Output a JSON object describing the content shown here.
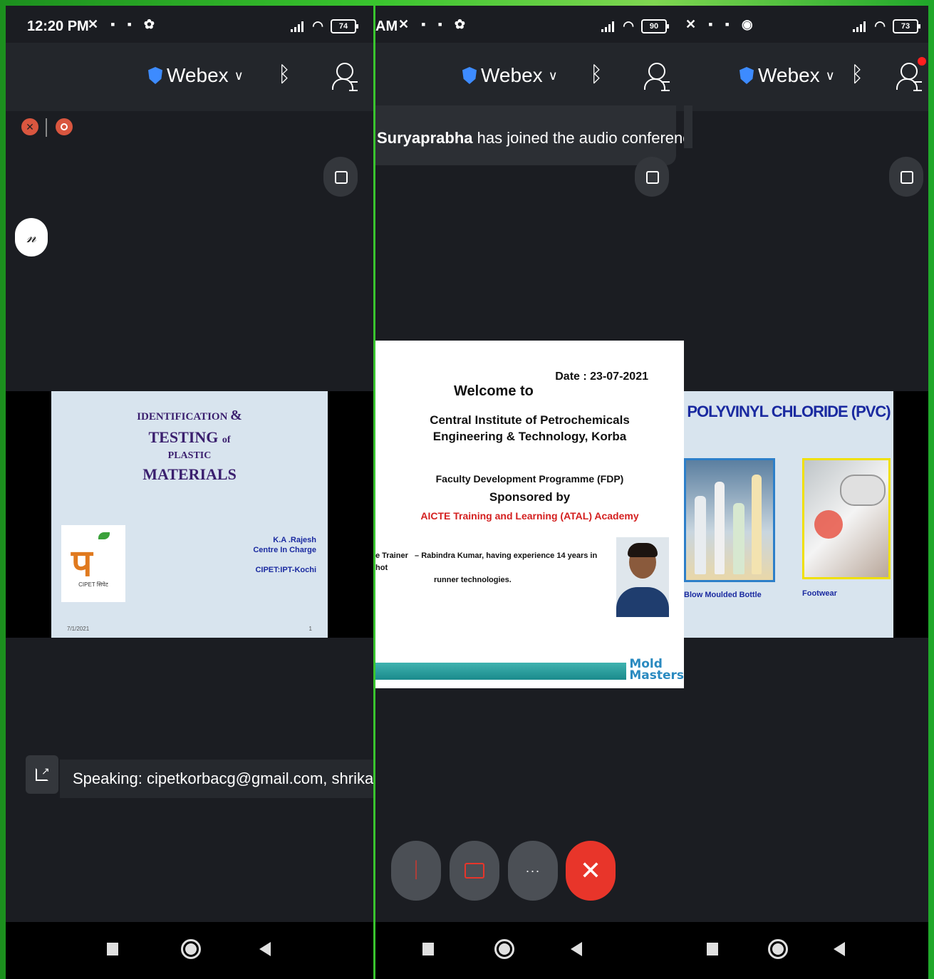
{
  "panel1": {
    "time": "12:20 PM",
    "battery": "74",
    "app_name": "Webex",
    "speaking": "Speaking: cipetkorbacg@gmail.com, shrika...",
    "slide": {
      "line1a": "IDENTIFICATION",
      "line1b": "&",
      "line2a": "TESTING",
      "line2b": "of",
      "line3": "PLASTIC",
      "line4": "MATERIALS",
      "presenter": "K.A .Rajesh",
      "role": "Centre In Charge",
      "org": "CIPET:IPT-Kochi",
      "date": "7/1/2021",
      "page": "1",
      "logo_text": "CIPET सिपेट"
    }
  },
  "panel2": {
    "time": "AM",
    "battery": "90",
    "app_name": "Webex",
    "toast_name": "Suryaprabha",
    "toast_text": " has joined the audio conference.",
    "slide": {
      "date": "Date : 23-07-2021",
      "welcome": "Welcome to",
      "inst1": "Central Institute of Petrochemicals",
      "inst2": "Engineering & Technology, Korba",
      "fdp": "Faculty Development Programme (FDP)",
      "sponsored": "Sponsored by",
      "aicte": "AICTE Training and Learning (ATAL) Academy",
      "trainer_label": "e Trainer",
      "trainer_text": "– Rabindra Kumar, having experience 14 years in hot",
      "trainer_text2": "runner technologies.",
      "brand1": "Mold",
      "brand2": "Masters"
    },
    "controls": {
      "more": "···"
    }
  },
  "panel3": {
    "battery": "73",
    "app_name": "Webex",
    "slide": {
      "title": "POLYVINYL CHLORIDE (PVC)",
      "cap1": "Blow Moulded Bottle",
      "cap2": "Footwear"
    }
  },
  "colors": {
    "end_call": "#e8352a",
    "accent": "#3d8bff",
    "aicte_red": "#d42020"
  }
}
